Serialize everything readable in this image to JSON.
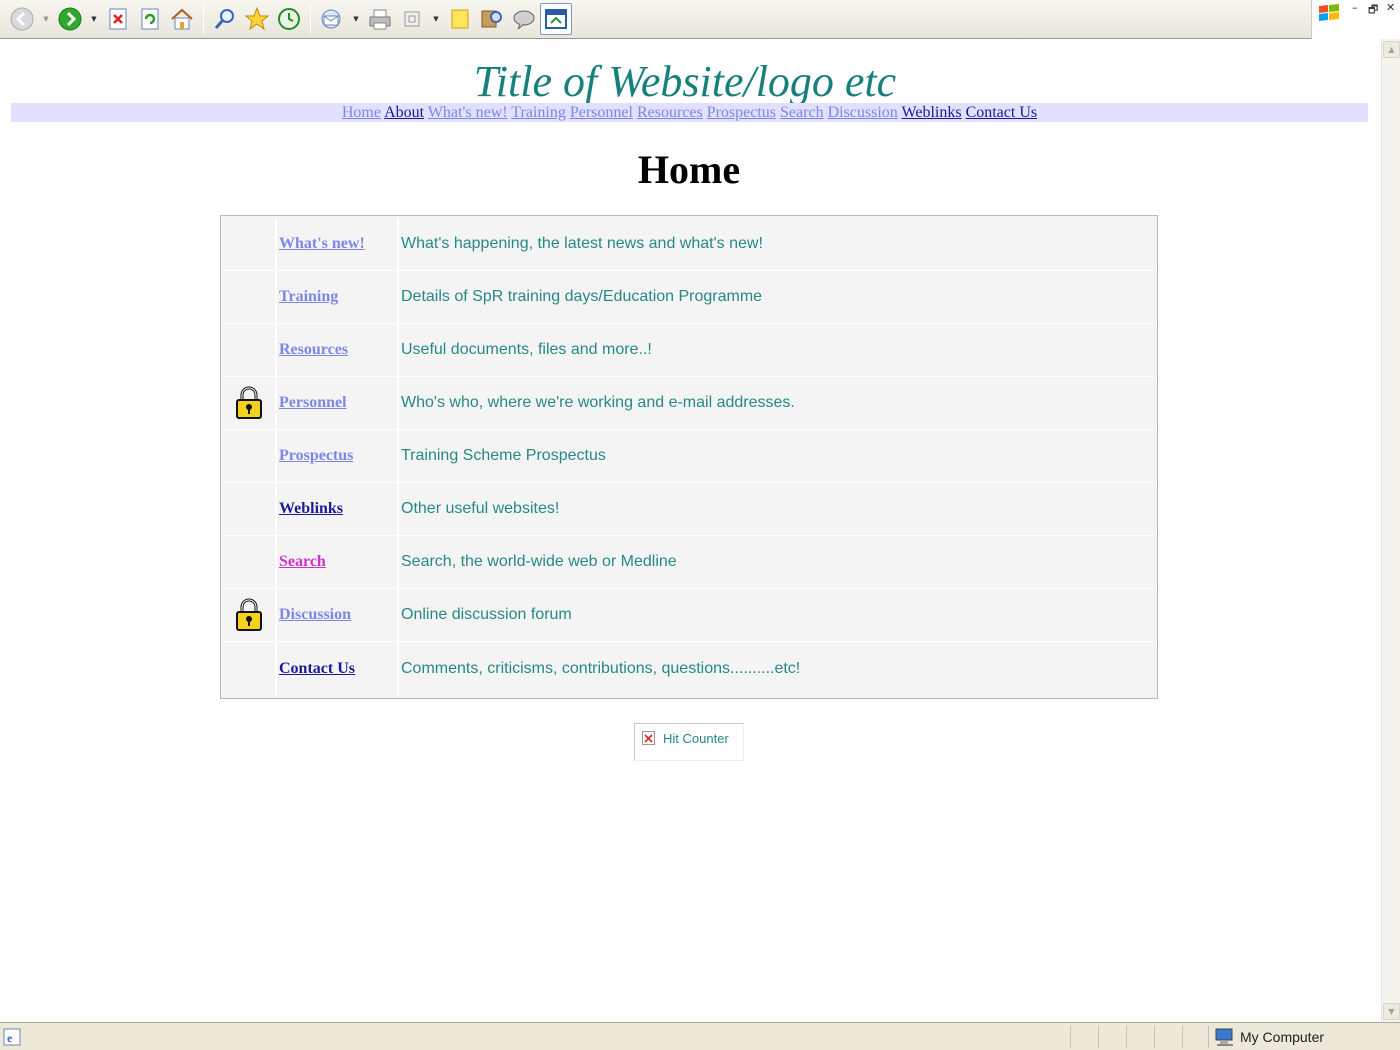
{
  "browser": {
    "status_zone": "My Computer"
  },
  "site": {
    "title": "Title of Website/logo etc",
    "nav": [
      {
        "label": "Home",
        "style": "light"
      },
      {
        "label": "About",
        "style": "dark"
      },
      {
        "label": "What's new!",
        "style": "light"
      },
      {
        "label": "Training",
        "style": "light"
      },
      {
        "label": "Personnel",
        "style": "light"
      },
      {
        "label": "Resources",
        "style": "light"
      },
      {
        "label": "Prospectus",
        "style": "light"
      },
      {
        "label": "Search",
        "style": "light"
      },
      {
        "label": "Discussion",
        "style": "light"
      },
      {
        "label": "Weblinks",
        "style": "dark"
      },
      {
        "label": "Contact Us",
        "style": "dark"
      }
    ]
  },
  "page": {
    "heading": "Home",
    "rows": [
      {
        "locked": false,
        "link": "What's new!",
        "style": "light",
        "description": "What's happening, the latest news and what's new!"
      },
      {
        "locked": false,
        "link": "Training",
        "style": "light",
        "description": "Details of SpR training days/Education Programme"
      },
      {
        "locked": false,
        "link": "Resources",
        "style": "light",
        "description": "Useful documents, files and more..!"
      },
      {
        "locked": true,
        "link": "Personnel",
        "style": "light",
        "description": "Who's who, where we're working and e-mail addresses."
      },
      {
        "locked": false,
        "link": "Prospectus",
        "style": "light",
        "description": "Training Scheme Prospectus"
      },
      {
        "locked": false,
        "link": "Weblinks",
        "style": "dark",
        "description": "Other useful websites!"
      },
      {
        "locked": false,
        "link": "Search",
        "style": "pink",
        "description": "Search, the world-wide web or Medline"
      },
      {
        "locked": true,
        "link": "Discussion",
        "style": "light",
        "description": "Online discussion forum"
      },
      {
        "locked": false,
        "link": "Contact Us",
        "style": "dark",
        "description": "Comments, criticisms, contributions, questions..........etc!"
      }
    ],
    "hit_counter_alt": "Hit Counter"
  }
}
